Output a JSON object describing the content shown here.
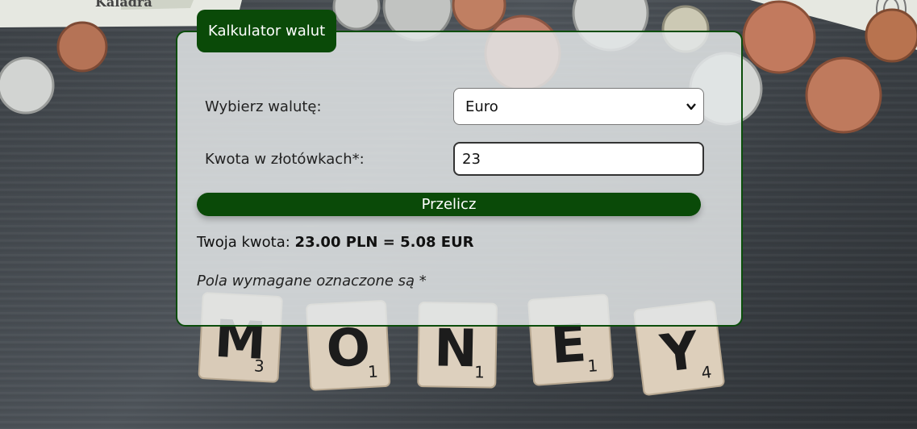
{
  "title": "Kalkulator walut",
  "form": {
    "currency_label": "Wybierz walutę:",
    "currency_value": "Euro",
    "amount_label": "Kwota w złotówkach*:",
    "amount_value": "23",
    "submit_label": "Przelicz"
  },
  "result": {
    "prefix": "Twoja kwota: ",
    "value": "23.00 PLN = 5.08 EUR"
  },
  "note": "Pola wymagane oznaczone są *",
  "tiles": [
    {
      "letter": "M",
      "score": "3"
    },
    {
      "letter": "O",
      "score": "1"
    },
    {
      "letter": "N",
      "score": "1"
    },
    {
      "letter": "E",
      "score": "1"
    },
    {
      "letter": "Y",
      "score": "4"
    }
  ],
  "banknote_text": "Kaladra",
  "colors": {
    "accent_green": "#0a4a08",
    "panel_border": "#0b4d0b"
  }
}
